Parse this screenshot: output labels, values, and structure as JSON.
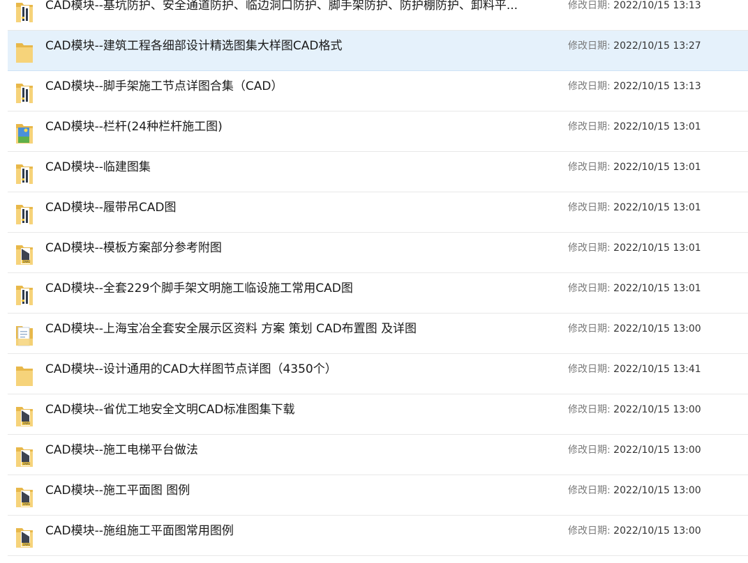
{
  "items": [
    {
      "name": "CAD模块--基坑防护、安全通道防护、临边洞口防护、脚手架防护、防护棚防护、卸料平...",
      "date_label": "修改日期:",
      "date": "2022/10/15 13:13",
      "icon": "zip-folder-icon",
      "selected": false
    },
    {
      "name": "CAD模块--建筑工程各细部设计精选图集大样图CAD格式",
      "date_label": "修改日期:",
      "date": "2022/10/15 13:27",
      "icon": "folder-icon",
      "selected": true
    },
    {
      "name": "CAD模块--脚手架施工节点详图合集（CAD）",
      "date_label": "修改日期:",
      "date": "2022/10/15 13:13",
      "icon": "zip-folder-icon",
      "selected": false
    },
    {
      "name": "CAD模块--栏杆(24种栏杆施工图)",
      "date_label": "修改日期:",
      "date": "2022/10/15 13:01",
      "icon": "image-folder-icon",
      "selected": false
    },
    {
      "name": "CAD模块--临建图集",
      "date_label": "修改日期:",
      "date": "2022/10/15 13:01",
      "icon": "zip-folder-icon",
      "selected": false
    },
    {
      "name": "CAD模块--履带吊CAD图",
      "date_label": "修改日期:",
      "date": "2022/10/15 13:01",
      "icon": "zip-folder-icon",
      "selected": false
    },
    {
      "name": "CAD模块--模板方案部分参考附图",
      "date_label": "修改日期:",
      "date": "2022/10/15 13:01",
      "icon": "dwg-folder-icon",
      "selected": false
    },
    {
      "name": "CAD模块--全套229个脚手架文明施工临设施工常用CAD图",
      "date_label": "修改日期:",
      "date": "2022/10/15 13:01",
      "icon": "zip-folder-icon",
      "selected": false
    },
    {
      "name": "CAD模块--上海宝冶全套安全展示区资料  方案  策划   CAD布置图 及详图",
      "date_label": "修改日期:",
      "date": "2022/10/15 13:00",
      "icon": "document-folder-icon",
      "selected": false
    },
    {
      "name": "CAD模块--设计通用的CAD大样图节点详图（4350个）",
      "date_label": "修改日期:",
      "date": "2022/10/15 13:41",
      "icon": "folder-icon",
      "selected": false
    },
    {
      "name": "CAD模块--省优工地安全文明CAD标准图集下载",
      "date_label": "修改日期:",
      "date": "2022/10/15 13:00",
      "icon": "dwg-folder-icon",
      "selected": false
    },
    {
      "name": "CAD模块--施工电梯平台做法",
      "date_label": "修改日期:",
      "date": "2022/10/15 13:00",
      "icon": "dwg-folder-icon",
      "selected": false
    },
    {
      "name": "CAD模块--施工平面图 图例",
      "date_label": "修改日期:",
      "date": "2022/10/15 13:00",
      "icon": "dwg-folder-icon",
      "selected": false
    },
    {
      "name": "CAD模块--施组施工平面图常用图例",
      "date_label": "修改日期:",
      "date": "2022/10/15 13:00",
      "icon": "dwg-folder-icon",
      "selected": false
    }
  ],
  "colors": {
    "folder": "#e8b84a",
    "folder_light": "#f6d37a",
    "selected_bg": "#e5f1fb",
    "zip_dark": "#2f3b4c",
    "dwg_dark": "#3d4350"
  }
}
